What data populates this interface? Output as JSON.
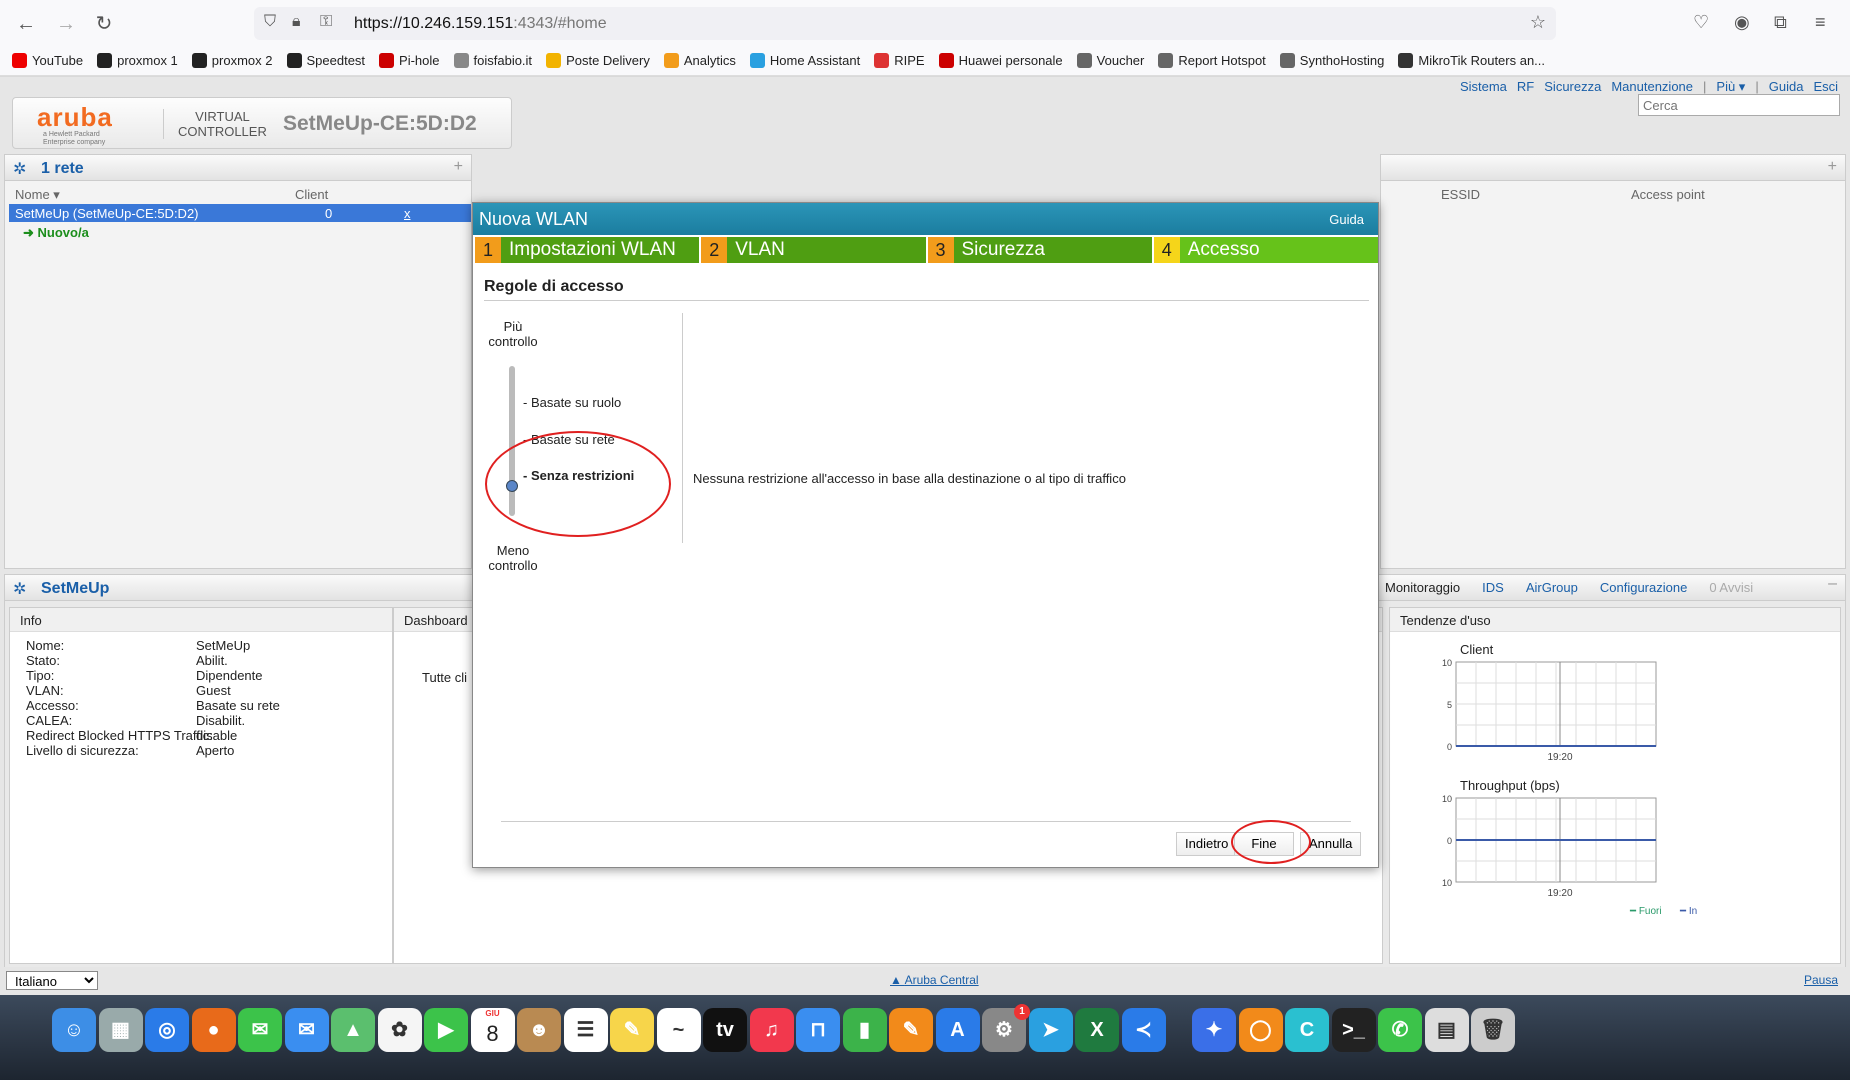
{
  "browser": {
    "url_host": "https://10.246.159.151",
    "url_rest": ":4343/#home",
    "bookmarks": [
      "YouTube",
      "proxmox 1",
      "proxmox 2",
      "Speedtest",
      "Pi-hole",
      "foisfabio.it",
      "Poste Delivery",
      "Analytics",
      "Home Assistant",
      "RIPE",
      "Huawei personale",
      "Voucher",
      "Report Hotspot",
      "SynthoHosting",
      "MikroTik Routers an..."
    ]
  },
  "topnav": [
    "Sistema",
    "RF",
    "Sicurezza",
    "Manutenzione",
    "|",
    "Più ▾",
    "|",
    "Guida",
    "Esci"
  ],
  "brand": {
    "logo": "aruba",
    "logo_sub": "a Hewlett Packard Enterprise company",
    "vc1": "VIRTUAL",
    "vc2": "CONTROLLER",
    "name": "SetMeUp-CE:5D:D2"
  },
  "search_placeholder": "Cerca",
  "networks": {
    "title": "1 rete",
    "col_name": "Nome ▾",
    "col_client": "Client",
    "row_name": "SetMeUp (SetMeUp-CE:5D:D2)",
    "row_client": "0",
    "row_x": "x",
    "new_link": "Nuovo/a"
  },
  "right_top": {
    "col_essid": "ESSID",
    "col_ap": "Access point"
  },
  "setmeup": {
    "title": "SetMeUp",
    "info_title": "Info",
    "info": [
      {
        "k": "Nome:",
        "v": "SetMeUp"
      },
      {
        "k": "Stato:",
        "v": "Abilit."
      },
      {
        "k": "Tipo:",
        "v": "Dipendente"
      },
      {
        "k": "VLAN:",
        "v": "Guest"
      },
      {
        "k": "Accesso:",
        "v": "Basate su rete"
      },
      {
        "k": "CALEA:",
        "v": "Disabilit."
      },
      {
        "k": "Redirect Blocked HTTPS Traffic:",
        "v": "disable"
      },
      {
        "k": "Livello di sicurezza:",
        "v": "Aperto"
      }
    ],
    "dashboard_title": "Dashboard",
    "dashboard_text": "Tutte cli"
  },
  "monitor": {
    "tabs": [
      "Monitoraggio",
      "IDS",
      "AirGroup",
      "Configurazione",
      "0 Avvisi"
    ],
    "trend_title": "Tendenze d'uso",
    "client_title": "Client",
    "throughput_title": "Throughput   (bps)",
    "time_label": "19:20",
    "legend_out": "Fuori",
    "legend_in": "In"
  },
  "chart_data": [
    {
      "type": "line",
      "title": "Client",
      "y_ticks": [
        "10",
        "5",
        "0"
      ],
      "ylim": [
        0,
        10
      ],
      "x": [
        "19:20"
      ],
      "series": [
        {
          "values": [
            0,
            0
          ]
        }
      ]
    },
    {
      "type": "line",
      "title": "Throughput   (bps)",
      "y_ticks": [
        "10",
        "0",
        "10"
      ],
      "ylim": [
        -10,
        10
      ],
      "x": [
        "19:20"
      ],
      "series": [
        {
          "name": "Fuori",
          "values": [
            0,
            0
          ]
        },
        {
          "name": "In",
          "values": [
            0,
            0
          ]
        }
      ]
    }
  ],
  "modal": {
    "title": "Nuova WLAN",
    "help": "Guida",
    "steps": [
      {
        "n": "1",
        "label": "Impostazioni WLAN"
      },
      {
        "n": "2",
        "label": "VLAN"
      },
      {
        "n": "3",
        "label": "Sicurezza"
      },
      {
        "n": "4",
        "label": "Accesso"
      }
    ],
    "section_title": "Regole di accesso",
    "more_control": "Più\ncontrollo",
    "less_control": "Meno\ncontrollo",
    "options": [
      "- Basate su ruolo",
      "- Basate su rete",
      "- Senza restrizioni"
    ],
    "description": "Nessuna restrizione all'accesso in base alla destinazione o al tipo di traffico",
    "btn_back": "Indietro",
    "btn_finish": "Fine",
    "btn_cancel": "Annulla"
  },
  "status": {
    "language": "Italiano",
    "central": "Aruba Central",
    "pause": "Pausa"
  },
  "dock_date": "8",
  "dock_month": "GIU",
  "dock_badge": "1",
  "colors": {
    "accent": "#1a5fa8",
    "step_green": "#4f9e12",
    "step_active": "#66c21a",
    "modal_head": "#1b7d9f",
    "highlight_red": "#e02020"
  }
}
